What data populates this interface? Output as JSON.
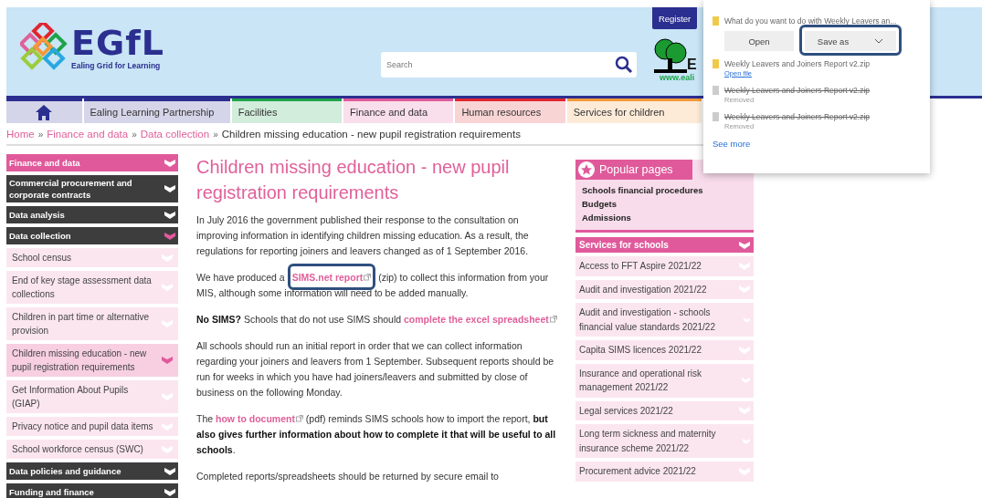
{
  "header": {
    "logo": {
      "mark": "EGfL",
      "tagline": "Ealing Grid for Learning"
    },
    "search": {
      "placeholder": "Search"
    },
    "register": "Register",
    "partner_logo": {
      "letter": "E",
      "url": "www.eali"
    }
  },
  "nav": [
    {
      "kind": "home",
      "color": "#2b2f8f"
    },
    {
      "kind": "link",
      "label": "Ealing Learning Partnership",
      "color": "#2b2f8f"
    },
    {
      "kind": "link",
      "label": "Facilities",
      "color": "#1fa34a"
    },
    {
      "kind": "link",
      "label": "Finance and data",
      "color": "#e05a9b"
    },
    {
      "kind": "link",
      "label": "Human resources",
      "color": "#e0262f"
    },
    {
      "kind": "link",
      "label": "Services for children",
      "color": "#f39a3a"
    }
  ],
  "breadcrumb": [
    {
      "kind": "link",
      "text": "Home"
    },
    {
      "kind": "separator",
      "text": "»"
    },
    {
      "kind": "link",
      "text": "Finance and data"
    },
    {
      "kind": "separator",
      "text": "»"
    },
    {
      "kind": "link",
      "text": "Data collection"
    },
    {
      "kind": "separator",
      "text": "»"
    },
    {
      "kind": "current",
      "text": "Children missing education - new pupil registration requirements"
    }
  ],
  "sidebar": [
    {
      "kind": "section",
      "label": "Finance and data",
      "expanded": false
    },
    {
      "kind": "group",
      "label": "Commercial procurement and corporate contracts",
      "expanded": false
    },
    {
      "kind": "group",
      "label": "Data analysis",
      "expanded": false
    },
    {
      "kind": "group",
      "label": "Data collection",
      "expanded": true
    },
    {
      "kind": "item",
      "label": "School census",
      "selected": false
    },
    {
      "kind": "item",
      "label": "End of key stage assessment data collections",
      "selected": false
    },
    {
      "kind": "item",
      "label": "Children in part time or alternative provision",
      "selected": false
    },
    {
      "kind": "item",
      "label": "Children missing education - new pupil registration requirements",
      "selected": true
    },
    {
      "kind": "item",
      "label": "Get Information About Pupils (GIAP)",
      "selected": false
    },
    {
      "kind": "item",
      "label": "Privacy notice and pupil data items",
      "selected": false
    },
    {
      "kind": "item",
      "label": "School workforce census (SWC)",
      "selected": false
    },
    {
      "kind": "group",
      "label": "Data policies and guidance",
      "expanded": false
    },
    {
      "kind": "group",
      "label": "Funding and finance",
      "expanded": false
    }
  ],
  "article": {
    "title": "Children missing education - new pupil registration requirements",
    "paragraphs": [
      [
        {
          "kind": "text",
          "text": "In July 2016 the government published their response to the consultation on improving information in identifying children missing education. As a result, the regulations for reporting joiners and leavers changed as of 1 September 2016."
        }
      ],
      [
        {
          "kind": "text",
          "text": "We have produced a "
        },
        {
          "kind": "link",
          "text": "SIMS.net report",
          "highlighted": true
        },
        {
          "kind": "text",
          "text": " (zip) to collect this information from your MIS, although some information will need to be added manually."
        }
      ],
      [
        {
          "kind": "bold",
          "text": "No SIMS?"
        },
        {
          "kind": "text",
          "text": " Schools that do not use SIMS should "
        },
        {
          "kind": "link",
          "text": "complete the excel spreadsheet",
          "highlighted": false
        }
      ],
      [
        {
          "kind": "text",
          "text": "All schools should run an initial report in order that we can collect information regarding your joiners and leavers from 1 September. Subsequent reports should be run for weeks in which you have had joiners/leavers and submitted by close of business on the following Monday."
        }
      ],
      [
        {
          "kind": "text",
          "text": "The "
        },
        {
          "kind": "link",
          "text": "how to document",
          "highlighted": false
        },
        {
          "kind": "text",
          "text": " (pdf) reminds SIMS schools how to import the report, "
        },
        {
          "kind": "bold",
          "text": "but also gives further information about how to complete it that will be useful to all schools"
        },
        {
          "kind": "text",
          "text": "."
        }
      ],
      [
        {
          "kind": "text",
          "text": "Completed reports/spreadsheets should be returned by secure email to"
        }
      ]
    ]
  },
  "popular": {
    "title": "Popular pages",
    "links": [
      "Schools financial procedures",
      "Budgets",
      "Admissions"
    ]
  },
  "services": {
    "title": "Services for schools",
    "items": [
      "Access to FFT Aspire 2021/22",
      "Audit and investigation 2021/22",
      "Audit and investigation - schools financial value standards 2021/22",
      "Capita SIMS licences 2021/22",
      "Insurance and operational risk management 2021/22",
      "Legal services 2021/22",
      "Long term sickness and maternity insurance scheme 2021/22",
      "Procurement advice 2021/22"
    ]
  },
  "downloads": {
    "question": "What do you want to do with Weekly Leavers an...",
    "open": "Open",
    "save_as": "Save as",
    "save_as_highlighted": true,
    "items": [
      {
        "name": "Weekly Leavers and Joiners Report v2.zip",
        "status": "Open file",
        "removed": false
      },
      {
        "name": "Weekly Leavers and Joiners Report v2.zip",
        "status": "Removed",
        "removed": true
      },
      {
        "name": "Weekly Leavers and Joiners Report v2.zip",
        "status": "Removed",
        "removed": true
      }
    ],
    "see_more": "See more"
  }
}
